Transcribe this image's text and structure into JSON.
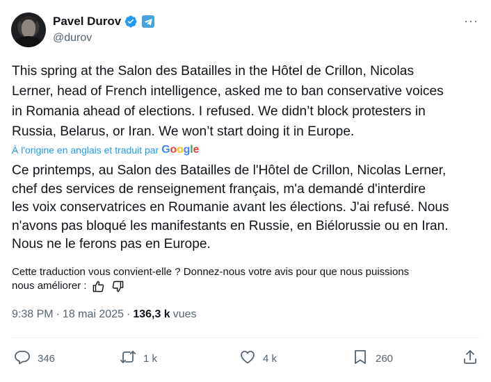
{
  "author": {
    "name": "Pavel Durov",
    "handle": "@durov",
    "more_icon": "···"
  },
  "tweet": {
    "text": "This spring at the Salon des Batailles in the Hôtel de Crillon, Nicolas\nLerner, head of French intelligence, asked me to ban conservative voices\nin Romania ahead of elections. I refused. We didn’t block protesters in\nRussia, Belarus, or Iran. We won’t start doing it in Europe.",
    "translated_note": "À l'origine en anglais et traduit par",
    "google_logo": "Google",
    "translation": "Ce printemps, au Salon des Batailles de l'Hôtel de Crillon, Nicolas Lerner,\nchef des services de renseignement français, m'a demandé d'interdire\nles voix conservatrices en Roumanie avant les élections. J'ai refusé. Nous\nn'avons pas bloqué les manifestants en Russie, en Biélorussie ou en Iran.\nNous ne le ferons pas en Europe."
  },
  "feedback": {
    "line1": "Cette traduction vous convient-elle ? Donnez-nous votre avis pour que nous puissions",
    "line2": "nous améliorer :"
  },
  "meta": {
    "time": "9:38 PM",
    "separator1": "·",
    "date": "18 mai 2025",
    "separator2": "·",
    "views_count": "136,3 k",
    "views_label": "vues"
  },
  "actions": {
    "replies": "346",
    "reposts": "1 k",
    "likes": "4 k",
    "bookmarks": "260"
  },
  "colors": {
    "link": "#1d9bf0",
    "secondary": "#536471",
    "verified": "#1d9bf0",
    "telegram": "#4aa1dc"
  }
}
